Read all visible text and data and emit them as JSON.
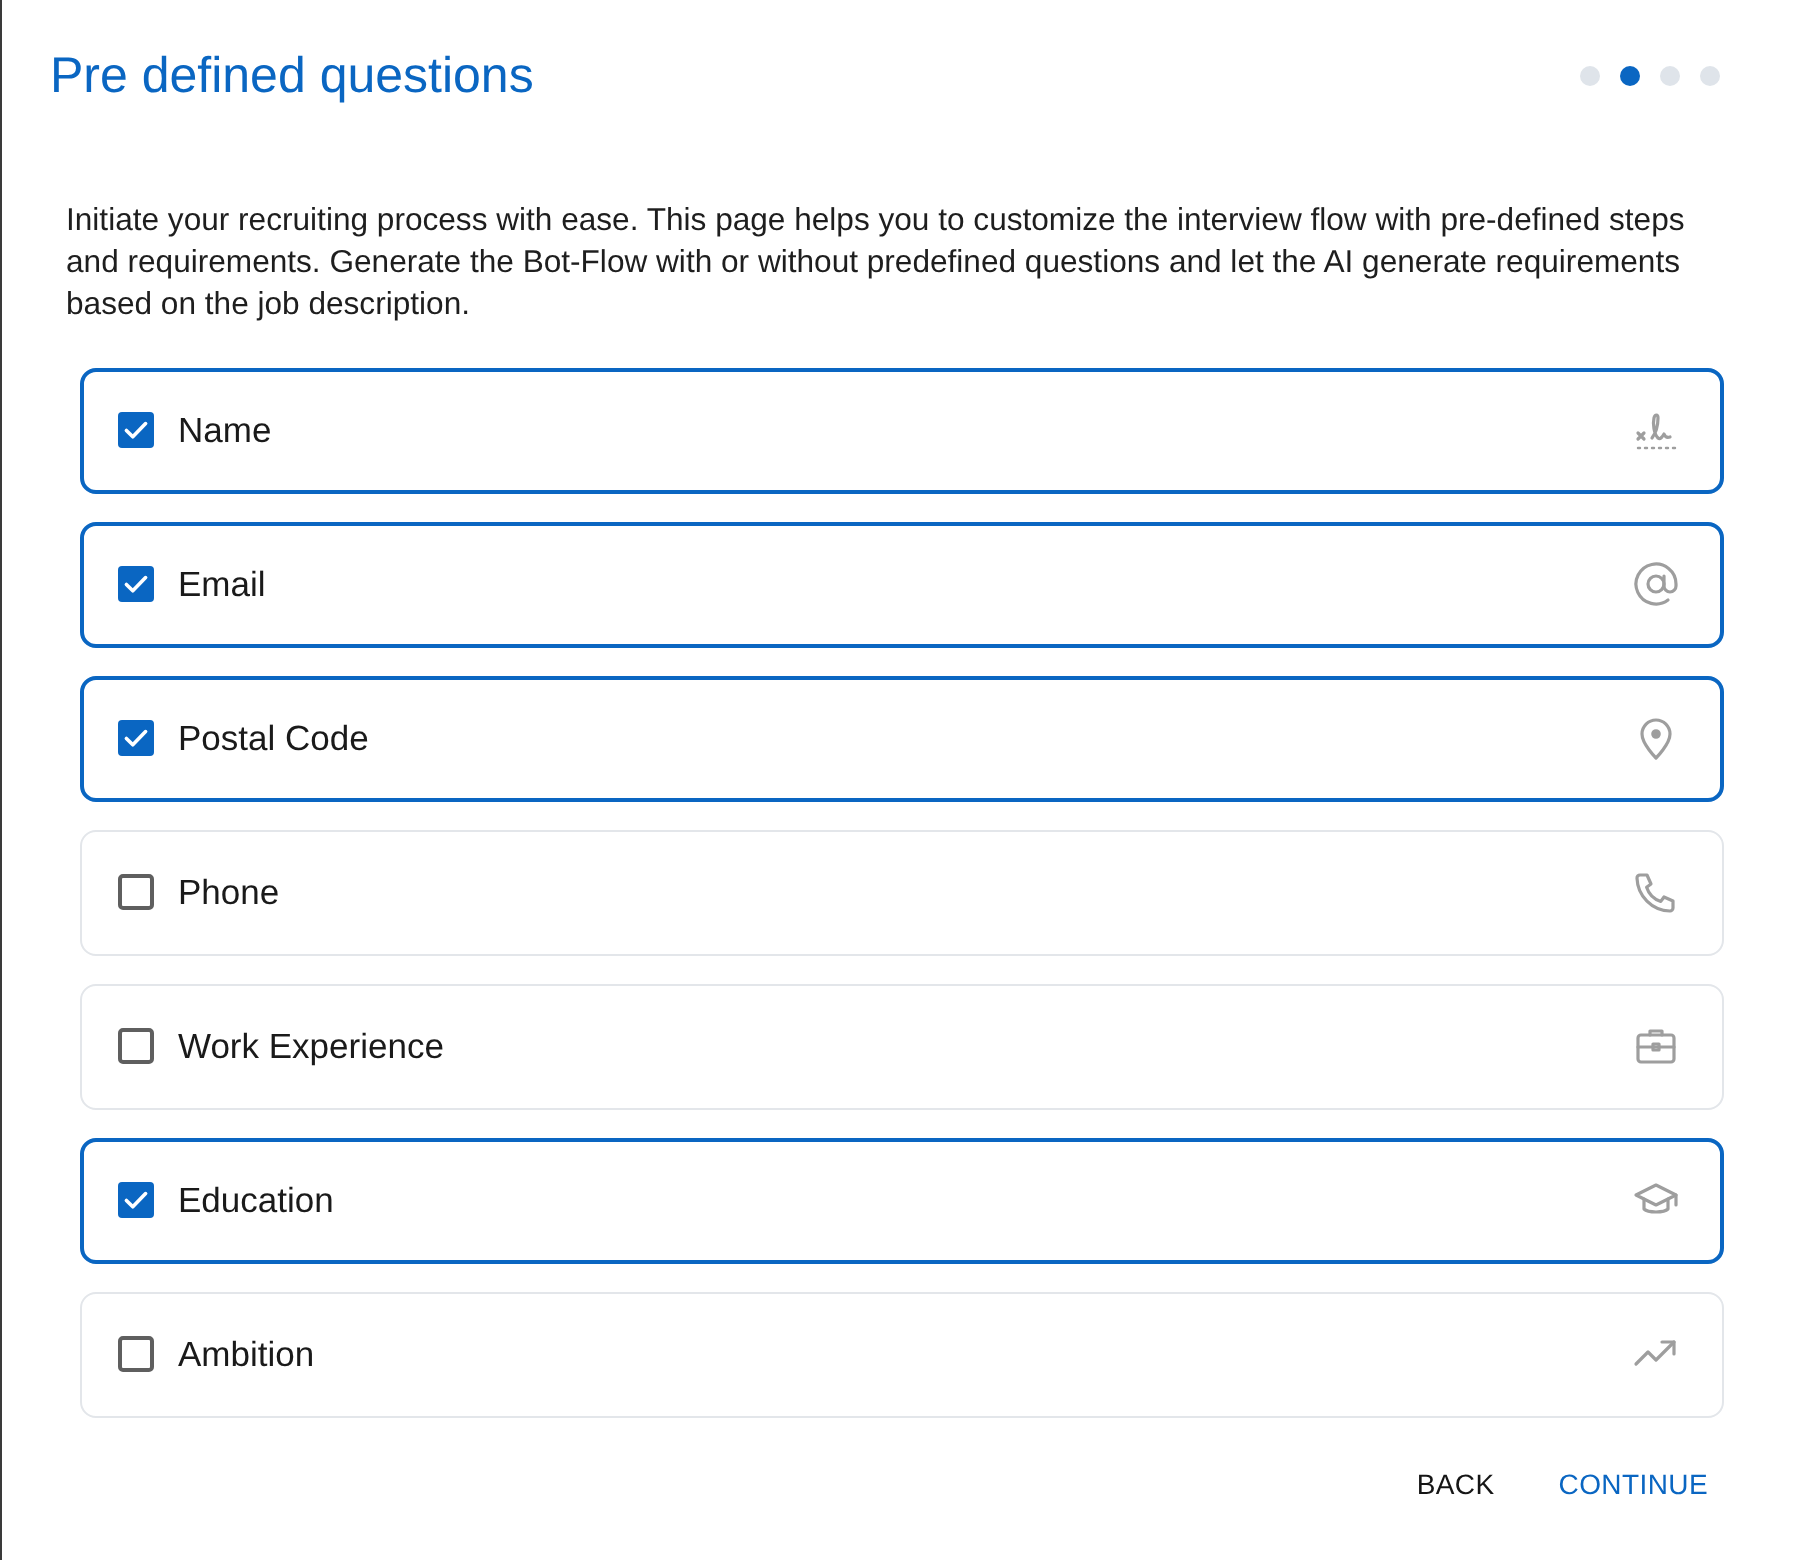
{
  "title": "Pre defined questions",
  "steps": [
    {
      "selected": false
    },
    {
      "selected": true
    },
    {
      "selected": false
    },
    {
      "selected": false
    }
  ],
  "description": "Initiate your recruiting process with ease. This page helps you to customize the interview flow with pre-defined steps and requirements. Generate the Bot-Flow with or without predefined questions and let the AI generate requirements based on the job description.",
  "questions": [
    {
      "label": "Name",
      "checked": true
    },
    {
      "label": "Email",
      "checked": true
    },
    {
      "label": "Postal Code",
      "checked": true
    },
    {
      "label": "Phone",
      "checked": false
    },
    {
      "label": "Work Experience",
      "checked": false
    },
    {
      "label": "Education",
      "checked": true
    },
    {
      "label": "Ambition",
      "checked": false
    }
  ],
  "buttons": [
    {
      "label": "BACK",
      "kind": "secondary"
    },
    {
      "label": "CONTINUE",
      "kind": "primary"
    }
  ]
}
